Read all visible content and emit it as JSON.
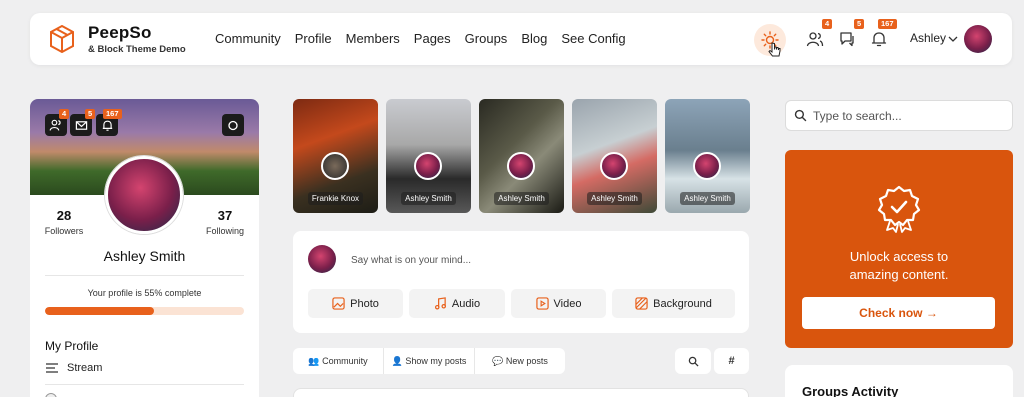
{
  "header": {
    "brand_title": "PeepSo",
    "brand_subtitle": "& Block Theme Demo",
    "nav": [
      "Community",
      "Profile",
      "Members",
      "Pages",
      "Groups",
      "Blog",
      "See Config"
    ],
    "badges": {
      "members": "4",
      "messages": "5",
      "notifications": "167"
    },
    "user_name": "Ashley"
  },
  "profile": {
    "badges": {
      "members": "4",
      "messages": "5",
      "notifications": "167"
    },
    "followers_count": "28",
    "followers_label": "Followers",
    "following_count": "37",
    "following_label": "Following",
    "name": "Ashley Smith",
    "completion_text": "Your profile is 55% complete",
    "completion_fraction": 0.55,
    "menu_title": "My Profile",
    "menu_item": "Stream"
  },
  "stories": [
    "Frankie Knox",
    "Ashley Smith",
    "Ashley Smith",
    "Ashley Smith",
    "Ashley Smith"
  ],
  "postbox": {
    "placeholder": "Say what is on your mind...",
    "buttons": [
      "Photo",
      "Audio",
      "Video",
      "Background"
    ]
  },
  "filters": {
    "tabs": [
      "Community",
      "Show my posts",
      "New posts"
    ]
  },
  "sidebar": {
    "search_placeholder": "Type to search...",
    "promo_line1": "Unlock access to",
    "promo_line2": "amazing content.",
    "promo_button": "Check now →",
    "groups_title": "Groups Activity"
  },
  "colors": {
    "accent": "#e8611c",
    "promo": "#d9550d"
  }
}
